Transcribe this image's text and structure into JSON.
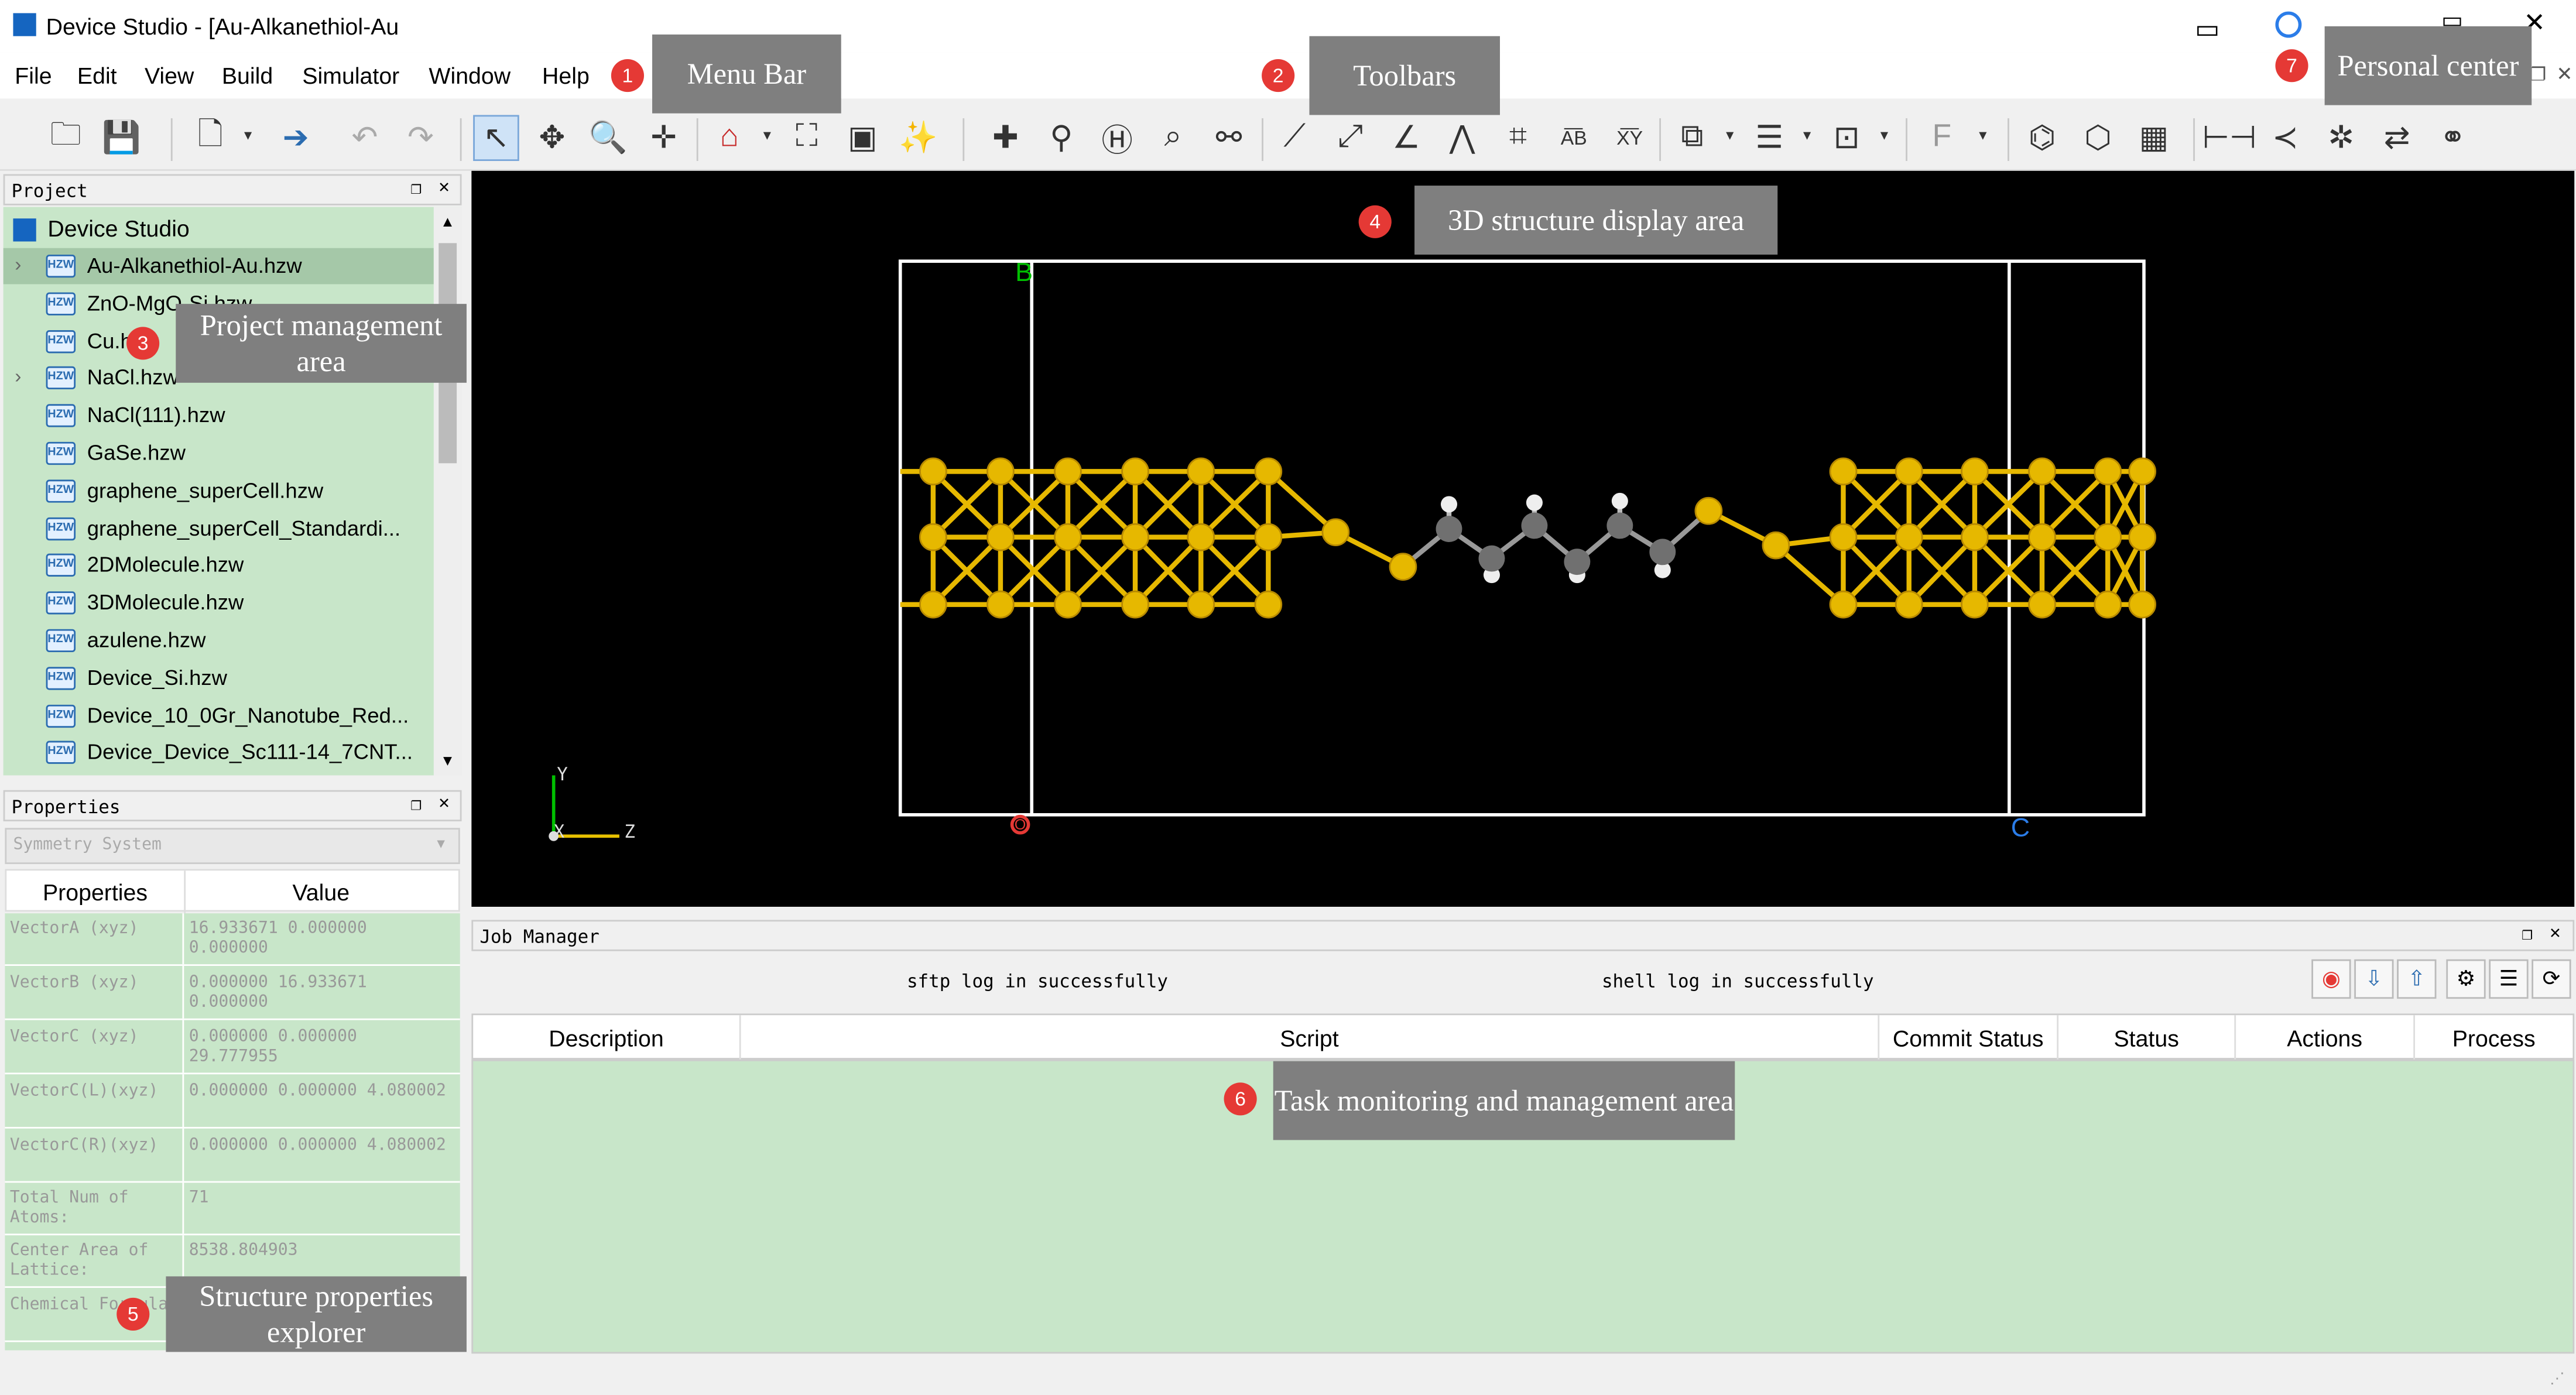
{
  "app": {
    "title": "Device Studio - [Au-Alkanethiol-Au"
  },
  "menu": {
    "items": [
      "File",
      "Edit",
      "View",
      "Build",
      "Simulator",
      "Window",
      "Help"
    ]
  },
  "project": {
    "header": "Project",
    "root": "Device Studio",
    "files": [
      "Au-Alkanethiol-Au.hzw",
      "ZnO-MgO-Si.hzw",
      "Cu.hzw",
      "NaCl.hzw",
      "NaCl(111).hzw",
      "GaSe.hzw",
      "graphene_superCell.hzw",
      "graphene_superCell_Standardi...",
      "2DMolecule.hzw",
      "3DMolecule.hzw",
      "azulene.hzw",
      "Device_Si.hzw",
      "Device_10_0Gr_Nanotube_Red...",
      "Device_Device_Sc111-14_7CNT..."
    ],
    "file_icon_text": "HZW"
  },
  "properties": {
    "header": "Properties",
    "dropdown": "Symmetry System",
    "col_properties": "Properties",
    "col_value": "Value",
    "rows": [
      {
        "k": "VectorA (xyz)",
        "v": "16.933671  0.000000  0.000000"
      },
      {
        "k": "VectorB (xyz)",
        "v": "0.000000  16.933671  0.000000"
      },
      {
        "k": "VectorC (xyz)",
        "v": "0.000000  0.000000  29.777955"
      },
      {
        "k": "VectorC(L)(xyz)",
        "v": "0.000000  0.000000  4.080002"
      },
      {
        "k": "VectorC(R)(xyz)",
        "v": "0.000000  0.000000  4.080002"
      },
      {
        "k": "Total Num of Atoms:",
        "v": "71"
      },
      {
        "k": "Center Area of Lattice:",
        "v": "8538.804903"
      },
      {
        "k": "Chemical Formula:",
        "v": ""
      }
    ]
  },
  "viewer": {
    "label_b": "B",
    "label_o": "O",
    "label_c": "C",
    "axis_y": "Y",
    "axis_x": "X",
    "axis_z": "Z"
  },
  "job": {
    "header": "Job Manager",
    "sftp": "sftp log in successfully",
    "shell": "shell log in successfully",
    "columns": [
      "Description",
      "Script",
      "Commit Status",
      "Status",
      "Actions",
      "Process"
    ]
  },
  "callouts": {
    "c1": {
      "n": "1",
      "text": "Menu Bar"
    },
    "c2": {
      "n": "2",
      "text": "Toolbars"
    },
    "c3": {
      "n": "3",
      "text": "Project management area"
    },
    "c4": {
      "n": "4",
      "text": "3D structure display area"
    },
    "c5": {
      "n": "5",
      "text": "Structure properties explorer"
    },
    "c6": {
      "n": "6",
      "text": "Task monitoring and management area"
    },
    "c7": {
      "n": "7",
      "text": "Personal center"
    }
  },
  "colors": {
    "green_panel": "#c8e6c9",
    "gold": "#e6b800",
    "carbon": "#707070",
    "hydrogen": "#eeeeee",
    "callout": "#7f7f7f",
    "badge": "#e53935"
  }
}
